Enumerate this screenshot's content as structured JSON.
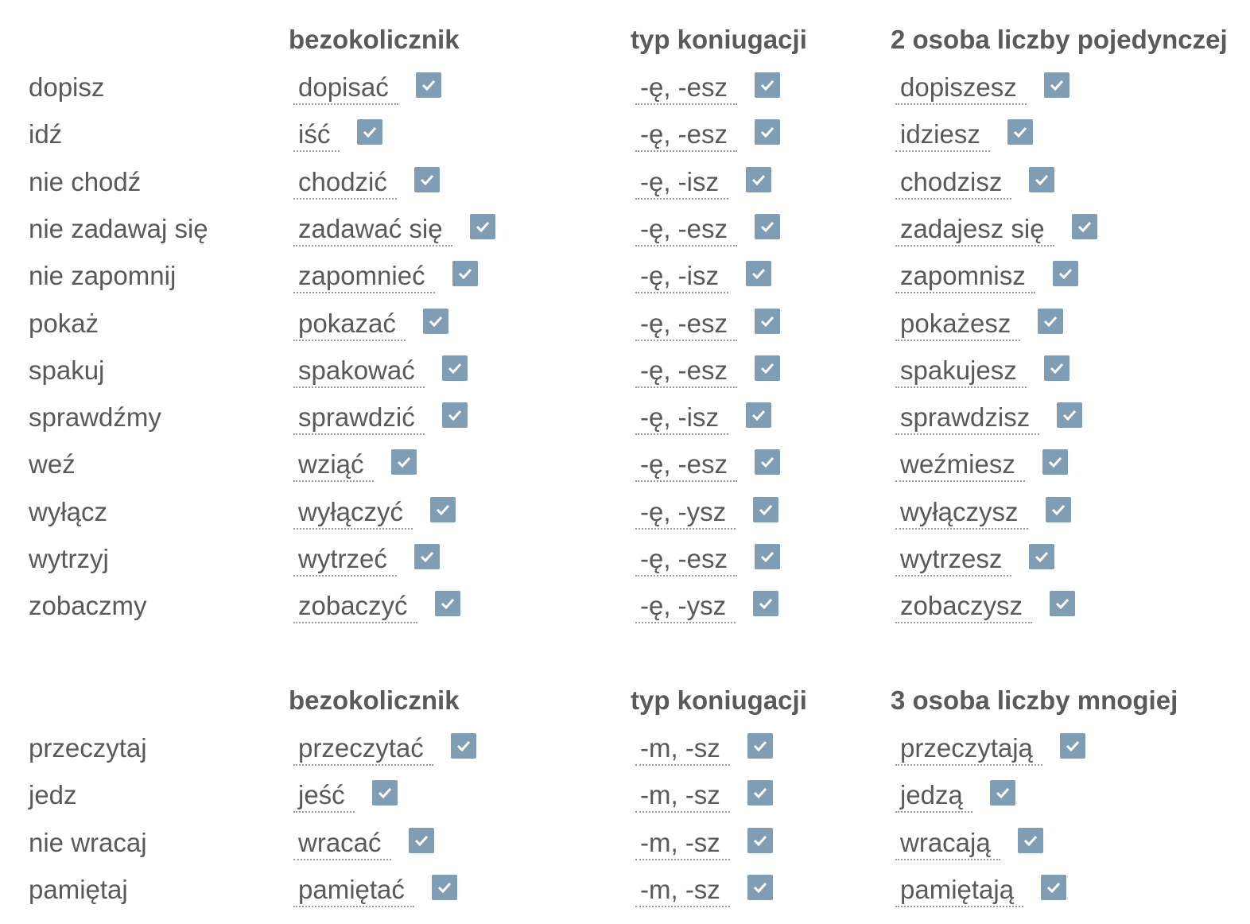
{
  "sections": [
    {
      "headers": {
        "infinitive": "bezokolicznik",
        "conjugation": "typ koniugacji",
        "form": "2 osoba liczby pojedynczej"
      },
      "rows": [
        {
          "prompt": "dopisz",
          "infinitive": "dopisać",
          "conjugation": "-ę, -esz",
          "form": "dopiszesz"
        },
        {
          "prompt": "idź",
          "infinitive": "iść",
          "conjugation": "-ę, -esz",
          "form": "idziesz"
        },
        {
          "prompt": "nie chodź",
          "infinitive": "chodzić",
          "conjugation": "-ę, -isz",
          "form": "chodzisz"
        },
        {
          "prompt": "nie zadawaj się",
          "infinitive": "zadawać się",
          "conjugation": "-ę, -esz",
          "form": "zadajesz się"
        },
        {
          "prompt": "nie zapomnij",
          "infinitive": "zapomnieć",
          "conjugation": "-ę, -isz",
          "form": "zapomnisz"
        },
        {
          "prompt": "pokaż",
          "infinitive": "pokazać",
          "conjugation": "-ę, -esz",
          "form": "pokażesz"
        },
        {
          "prompt": "spakuj",
          "infinitive": "spakować",
          "conjugation": "-ę, -esz",
          "form": "spakujesz"
        },
        {
          "prompt": "sprawdźmy",
          "infinitive": "sprawdzić",
          "conjugation": "-ę, -isz",
          "form": "sprawdzisz"
        },
        {
          "prompt": "weź",
          "infinitive": "wziąć",
          "conjugation": "-ę, -esz",
          "form": "weźmiesz"
        },
        {
          "prompt": "wyłącz",
          "infinitive": "wyłączyć",
          "conjugation": "-ę, -ysz",
          "form": "wyłączysz"
        },
        {
          "prompt": "wytrzyj",
          "infinitive": "wytrzeć",
          "conjugation": "-ę, -esz",
          "form": "wytrzesz"
        },
        {
          "prompt": "zobaczmy",
          "infinitive": "zobaczyć",
          "conjugation": "-ę, -ysz",
          "form": "zobaczysz"
        }
      ]
    },
    {
      "headers": {
        "infinitive": "bezokolicznik",
        "conjugation": "typ koniugacji",
        "form": "3 osoba liczby mnogiej"
      },
      "rows": [
        {
          "prompt": "przeczytaj",
          "infinitive": "przeczytać",
          "conjugation": "-m, -sz",
          "form": "przeczytają"
        },
        {
          "prompt": "jedz",
          "infinitive": "jeść",
          "conjugation": "-m, -sz",
          "form": "jedzą"
        },
        {
          "prompt": "nie wracaj",
          "infinitive": "wracać",
          "conjugation": "-m, -sz",
          "form": "wracają"
        },
        {
          "prompt": "pamiętaj",
          "infinitive": "pamiętać",
          "conjugation": "-m, -sz",
          "form": "pamiętają"
        }
      ]
    }
  ],
  "colors": {
    "checkbox": "#7f9db5",
    "text": "#595959"
  },
  "icons": {
    "check": "checkmark-icon"
  }
}
